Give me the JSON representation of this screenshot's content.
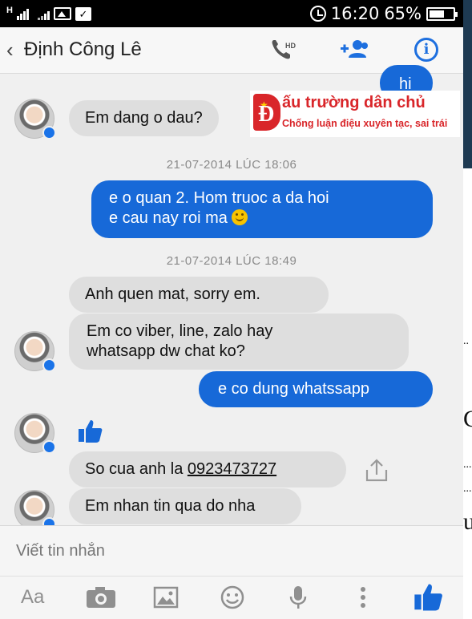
{
  "status_bar": {
    "time": "16:20",
    "battery_percent": "65%",
    "battery_level": 0.65,
    "network_label": "H"
  },
  "header": {
    "back_glyph": "‹",
    "contact_name": "Định Công Lê",
    "call_badge": "HD"
  },
  "watermark": {
    "title": "ấu trường dân chủ",
    "subtitle": "Chống luận điệu xuyên tạc, sai trái",
    "logo_letter": "Đ"
  },
  "messages": [
    {
      "from": "me",
      "text": "hi"
    },
    {
      "from": "contact",
      "text": "Em dang o dau?"
    },
    {
      "type": "timestamp",
      "text": "21-07-2014 LÚC 18:06"
    },
    {
      "from": "me",
      "text_line1": "e o quan 2. Hom truoc a da hoi",
      "text_line2": "e cau nay roi ma"
    },
    {
      "type": "timestamp",
      "text": "21-07-2014 LÚC 18:49"
    },
    {
      "from": "contact",
      "text": "Anh quen mat, sorry em."
    },
    {
      "from": "contact",
      "text_line1": "Em co viber, line, zalo hay",
      "text_line2": "whatsapp dw chat ko?"
    },
    {
      "from": "me",
      "text": "e co dung whatssapp"
    },
    {
      "from": "contact",
      "type": "like"
    },
    {
      "from": "contact",
      "text_prefix": "So cua anh la ",
      "phone": "0923473727"
    },
    {
      "from": "contact",
      "text": "Em nhan tin qua do nha"
    }
  ],
  "composer": {
    "placeholder": "Viết tin nhắn",
    "text_tool_label": "Aa"
  },
  "side_fragment": {
    "dots_1": "..",
    "letter_1": "C",
    "dots_2": "...",
    "dots_3": "...",
    "letter_2": "u"
  },
  "colors": {
    "accent": "#1769d8",
    "incoming_bubble": "#dedede",
    "watermark_red": "#d9262a"
  },
  "icons": [
    "signal-icon",
    "image-icon",
    "check-icon",
    "alarm-icon",
    "battery-icon",
    "phone-icon",
    "add-people-icon",
    "info-icon",
    "thumbs-up-icon",
    "share-icon",
    "camera-icon",
    "gallery-icon",
    "emoji-icon",
    "microphone-icon",
    "more-icon"
  ]
}
